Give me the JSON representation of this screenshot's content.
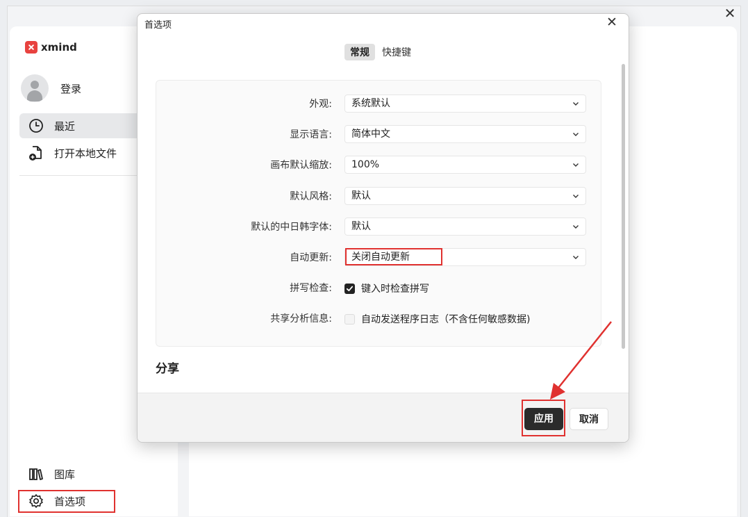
{
  "app": {
    "name": "xmind",
    "login_label": "登录",
    "nav": [
      {
        "label": "最近",
        "icon": "clock-icon",
        "active": true
      },
      {
        "label": "打开本地文件",
        "icon": "open-file-icon",
        "active": false
      }
    ],
    "bottom_nav": [
      {
        "label": "图库",
        "icon": "library-icon"
      },
      {
        "label": "首选项",
        "icon": "gear-icon"
      }
    ]
  },
  "dialog": {
    "title": "首选项",
    "tabs": [
      {
        "label": "常规",
        "active": true
      },
      {
        "label": "快捷键",
        "active": false
      }
    ],
    "settings": [
      {
        "label": "外观:",
        "type": "select",
        "value": "系统默认"
      },
      {
        "label": "显示语言:",
        "type": "select",
        "value": "简体中文"
      },
      {
        "label": "画布默认缩放:",
        "type": "select",
        "value": "100%"
      },
      {
        "label": "默认风格:",
        "type": "select",
        "value": "默认"
      },
      {
        "label": "默认的中日韩字体:",
        "type": "select",
        "value": "默认"
      },
      {
        "label": "自动更新:",
        "type": "select",
        "value": "关闭自动更新"
      },
      {
        "label": "拼写检查:",
        "type": "checkbox",
        "value": "键入时检查拼写",
        "checked": true
      },
      {
        "label": "共享分析信息:",
        "type": "checkbox",
        "value": "自动发送程序日志（不含任何敏感数据)",
        "checked": false
      }
    ],
    "section_title": "分享",
    "apply_label": "应用",
    "cancel_label": "取消"
  },
  "colors": {
    "highlight": "#e0312f",
    "brand": "#e8423f",
    "primary_button": "#2b2b2b"
  }
}
